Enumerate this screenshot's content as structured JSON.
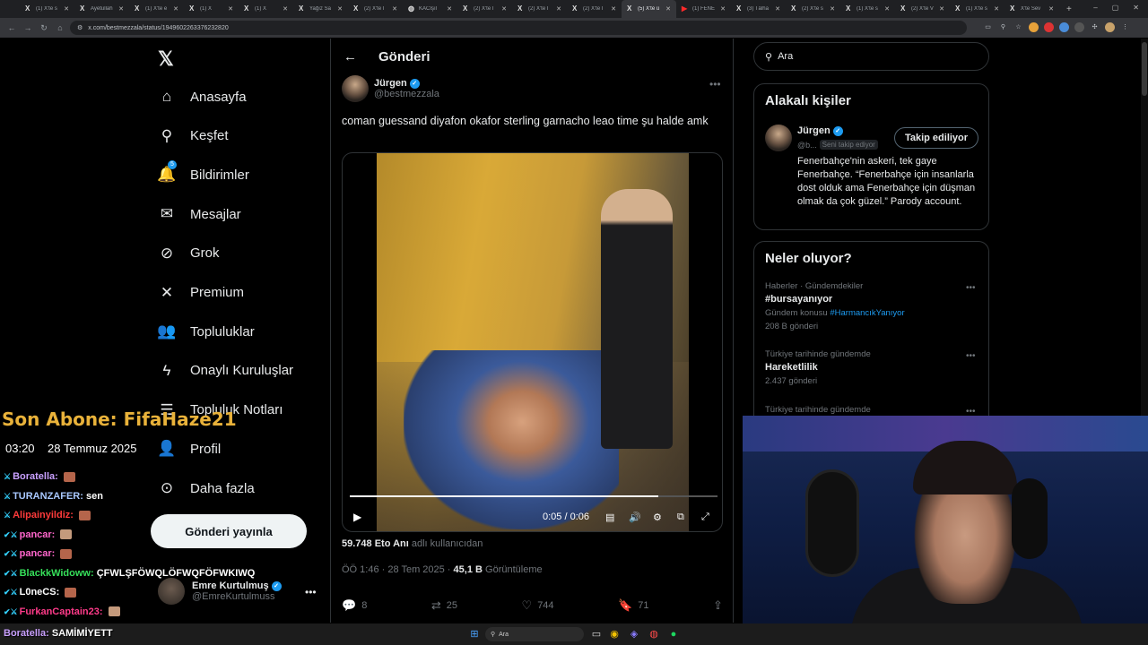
{
  "browser": {
    "tabs": [
      {
        "label": "(1) X'te s",
        "icon": "x-icon"
      },
      {
        "label": "Ayetullah",
        "icon": "x-icon"
      },
      {
        "label": "(1) X'te e",
        "icon": "x-icon"
      },
      {
        "label": "(1) X",
        "icon": "x-icon"
      },
      {
        "label": "(1) X",
        "icon": "x-icon"
      },
      {
        "label": "Yağız Sa",
        "icon": "x-icon"
      },
      {
        "label": "(2) X'te I",
        "icon": "x-icon"
      },
      {
        "label": "KACIşıl",
        "icon": "globe-icon"
      },
      {
        "label": "(2) X'te I",
        "icon": "x-icon"
      },
      {
        "label": "(2) X'te I",
        "icon": "x-icon"
      },
      {
        "label": "(2) X'te I",
        "icon": "x-icon"
      },
      {
        "label": "(5) X'te ü",
        "icon": "x-icon",
        "active": true
      },
      {
        "label": "(1) FENE",
        "icon": "youtube-icon"
      },
      {
        "label": "(3) Tâlha",
        "icon": "x-icon"
      },
      {
        "label": "(2) X'te s",
        "icon": "x-icon"
      },
      {
        "label": "(1) X'te s",
        "icon": "x-icon"
      },
      {
        "label": "(2) X'te V",
        "icon": "x-icon"
      },
      {
        "label": "(1) X'te s",
        "icon": "x-icon"
      },
      {
        "label": "X'te Sev",
        "icon": "x-icon"
      }
    ],
    "url": "x.com/bestmezzala/status/1949602263376232820"
  },
  "nav": {
    "items": [
      {
        "label": "Anasayfa",
        "icon": "home-icon",
        "glyph": "⌂"
      },
      {
        "label": "Keşfet",
        "icon": "search-icon",
        "glyph": "⚲"
      },
      {
        "label": "Bildirimler",
        "icon": "bell-icon",
        "glyph": "🔔",
        "badge": "5"
      },
      {
        "label": "Mesajlar",
        "icon": "mail-icon",
        "glyph": "✉"
      },
      {
        "label": "Grok",
        "icon": "grok-icon",
        "glyph": "⊘"
      },
      {
        "label": "Premium",
        "icon": "x-premium-icon",
        "glyph": "✕"
      },
      {
        "label": "Topluluklar",
        "icon": "communities-icon",
        "glyph": "👥"
      },
      {
        "label": "Onaylı Kuruluşlar",
        "icon": "lightning-icon",
        "glyph": "ϟ"
      },
      {
        "label": "Topluluk Notları",
        "icon": "notes-icon",
        "glyph": "☰"
      },
      {
        "label": "Profil",
        "icon": "profile-icon",
        "glyph": "👤"
      },
      {
        "label": "Daha fazla",
        "icon": "more-circle-icon",
        "glyph": "⊙"
      }
    ],
    "post_button": "Gönderi yayınla",
    "account": {
      "name": "Emre Kurtulmuş",
      "handle": "@EmreKurtulmuss"
    }
  },
  "main": {
    "title": "Gönderi",
    "author": {
      "name": "Jürgen",
      "handle": "@bestmezzala"
    },
    "text": "coman guessand diyafon okafor sterling garnacho leao time şu halde amk",
    "video": {
      "time": "0:05 / 0:06",
      "progress": 0.84
    },
    "views_by": {
      "count": "59.748 Eto Anı",
      "suffix": "adlı kullanıcıdan"
    },
    "meta": {
      "time": "ÖÖ 1:46 · 28 Tem 2025 ·",
      "views": "45,1 B",
      "views_label": "Görüntüleme"
    },
    "actions": {
      "replies": "8",
      "reposts": "25",
      "likes": "744",
      "bookmarks": "71"
    }
  },
  "right": {
    "search_placeholder": "Ara",
    "related": {
      "title": "Alakalı kişiler",
      "name": "Jürgen",
      "handle": "@b...",
      "follows_you": "Seni takip ediyor",
      "follow_button": "Takip ediliyor",
      "bio": "Fenerbahçe'nin askeri, tek gaye Fenerbahçe. “Fenerbahçe için insanlarla dost olduk ama Fenerbahçe için düşman olmak da çok güzel.” Parody account."
    },
    "trends": {
      "title": "Neler oluyor?",
      "items": [
        {
          "context": "Haberler · Gündemdekiler",
          "name": "#bursayanıyor",
          "sub_prefix": "Gündem konusu",
          "sub_link": "#HarmancıkYanıyor",
          "count": "208 B gönderi"
        },
        {
          "context": "Türkiye tarihinde gündemde",
          "name": "Hareketlilik",
          "sub_prefix": "",
          "sub_link": "",
          "count": "2.437 gönderi"
        },
        {
          "context": "Türkiye tarihinde gündemde",
          "name": "",
          "sub_prefix": "",
          "sub_link": "",
          "count": ""
        }
      ]
    }
  },
  "stream": {
    "last_sub": "Son Abone: FifaHaze21",
    "clock": "03:20",
    "date": "28 Temmuz 2025",
    "chat": [
      {
        "user": "Boratella:",
        "text": "",
        "color": "#c9a0ff",
        "emote": true
      },
      {
        "user": "TURANZAFER:",
        "text": "sen",
        "color": "#a8c8ff",
        "emote": false
      },
      {
        "user": "Alipainyildiz:",
        "text": "",
        "color": "#ff3b3b",
        "emote": true
      },
      {
        "user": "pancar:",
        "text": "",
        "color": "#ff66cc",
        "emote": true
      },
      {
        "user": "pancar:",
        "text": "",
        "color": "#ff66cc",
        "emote": true
      },
      {
        "user": "BlackkWidoww:",
        "text": "ÇFWLŞFÖWQLÖFWQFÖFWKIWQ",
        "color": "#36e05a",
        "emote": false
      },
      {
        "user": "L0neCS:",
        "text": "",
        "color": "#ffffff",
        "emote": true
      },
      {
        "user": "FurkanCaptain23:",
        "text": "",
        "color": "#ff3b8a",
        "emote": true
      }
    ],
    "chat_last": {
      "user": "Boratella:",
      "text": "SAMİMİYETT",
      "color": "#c9a0ff"
    }
  },
  "taskbar": {
    "search": "Ara"
  }
}
